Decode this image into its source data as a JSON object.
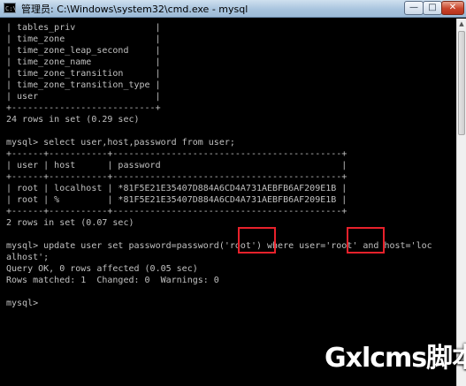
{
  "window": {
    "title": "管理员: C:\\Windows\\system32\\cmd.exe - mysql",
    "icon_label": "C:\\",
    "minimize_glyph": "—",
    "maximize_glyph": "□",
    "close_glyph": "✕"
  },
  "console": {
    "lines": [
      "| tables_priv               |",
      "| time_zone                 |",
      "| time_zone_leap_second     |",
      "| time_zone_name            |",
      "| time_zone_transition      |",
      "| time_zone_transition_type |",
      "| user                      |",
      "+---------------------------+",
      "24 rows in set (0.29 sec)",
      "",
      "mysql> select user,host,password from user;",
      "+------+-----------+-------------------------------------------+",
      "| user | host      | password                                  |",
      "+------+-----------+-------------------------------------------+",
      "| root | localhost | *81F5E21E35407D884A6CD4A731AEBFB6AF209E1B |",
      "| root | %         | *81F5E21E35407D884A6CD4A731AEBFB6AF209E1B |",
      "+------+-----------+-------------------------------------------+",
      "2 rows in set (0.07 sec)",
      "",
      "mysql> update user set password=password('root') where user='root' and host='loc",
      "alhost';",
      "Query OK, 0 rows affected (0.05 sec)",
      "Rows matched: 1  Changed: 0  Warnings: 0",
      "",
      "mysql>"
    ]
  },
  "colors": {
    "console_text": "#c0c0c0",
    "console_background": "#000000",
    "highlight_box": "#e8212b"
  },
  "watermark": {
    "text": "Gxlcms脚本"
  }
}
